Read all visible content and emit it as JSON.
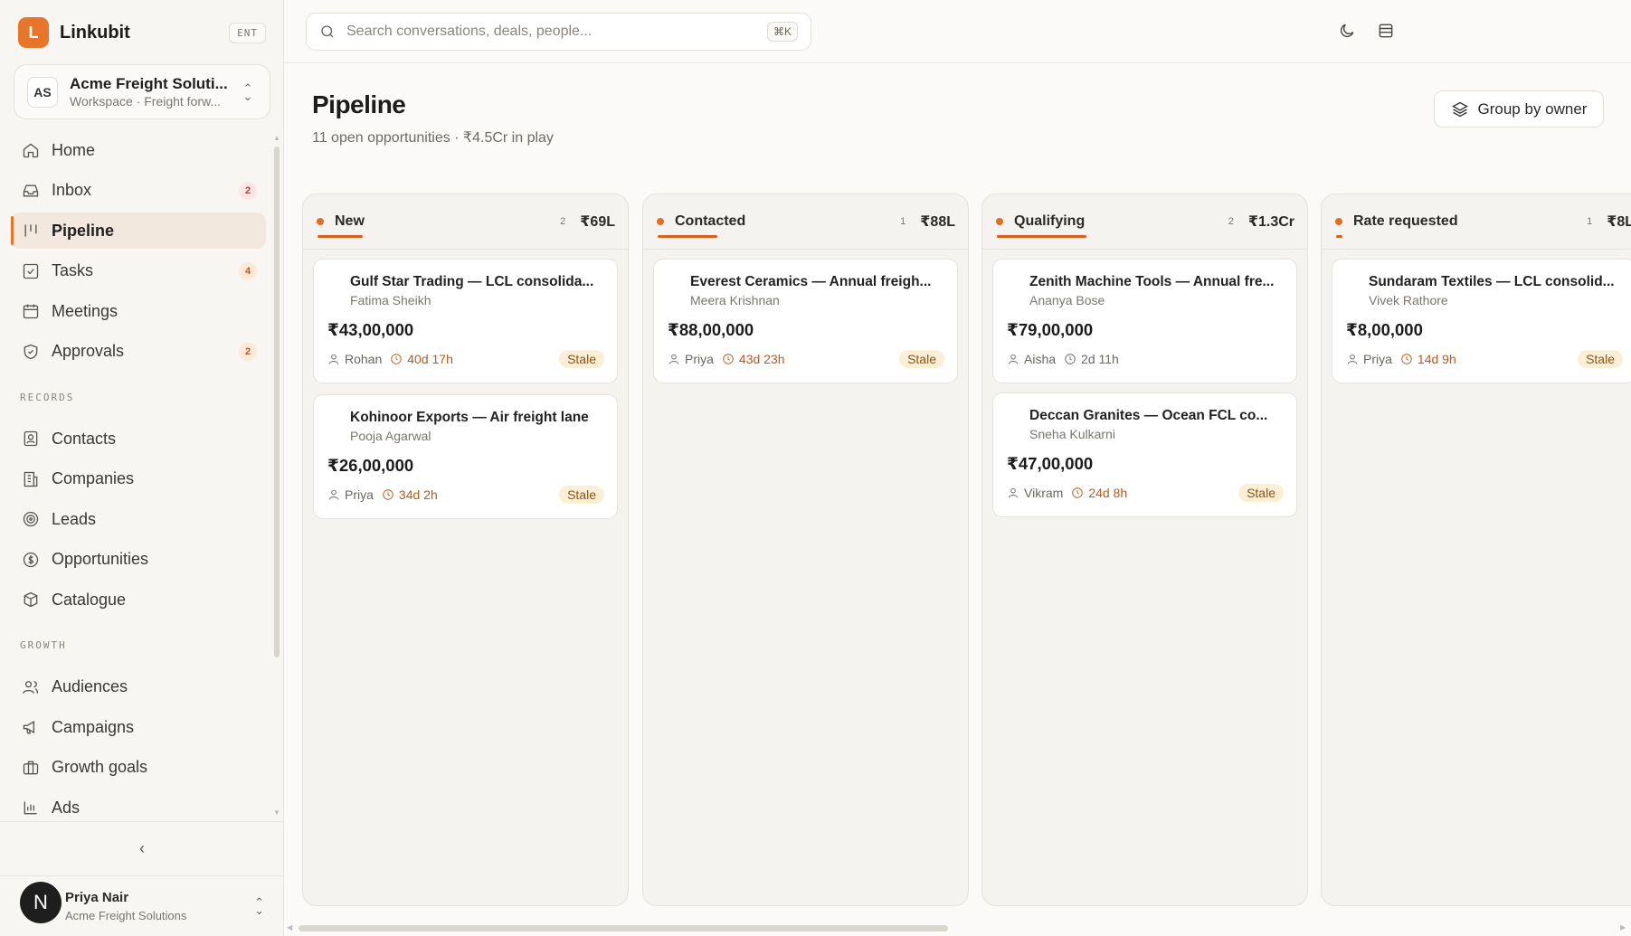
{
  "brand": {
    "logo_letter": "L",
    "name": "Linkubit",
    "badge": "ENT"
  },
  "workspace": {
    "initials": "AS",
    "name": "Acme Freight Soluti...",
    "subtitle": "Workspace · Freight forw..."
  },
  "nav": {
    "main": [
      {
        "label": "Home",
        "icon": "home-icon"
      },
      {
        "label": "Inbox",
        "icon": "inbox-icon",
        "count": "2"
      },
      {
        "label": "Pipeline",
        "icon": "pipeline-icon",
        "active": true
      },
      {
        "label": "Tasks",
        "icon": "tasks-icon",
        "count": "4"
      },
      {
        "label": "Meetings",
        "icon": "calendar-icon"
      },
      {
        "label": "Approvals",
        "icon": "shield-icon",
        "count": "2"
      }
    ],
    "records_label": "RECORDS",
    "records": [
      {
        "label": "Contacts",
        "icon": "contact-icon"
      },
      {
        "label": "Companies",
        "icon": "building-icon"
      },
      {
        "label": "Leads",
        "icon": "target-icon"
      },
      {
        "label": "Opportunities",
        "icon": "dollar-icon"
      },
      {
        "label": "Catalogue",
        "icon": "box-icon"
      }
    ],
    "growth_label": "GROWTH",
    "growth": [
      {
        "label": "Audiences",
        "icon": "users-icon"
      },
      {
        "label": "Campaigns",
        "icon": "megaphone-icon"
      },
      {
        "label": "Growth goals",
        "icon": "briefcase-icon"
      },
      {
        "label": "Ads",
        "icon": "bar-chart-icon"
      }
    ]
  },
  "user": {
    "initial": "N",
    "name": "Priya Nair",
    "org": "Acme Freight Solutions"
  },
  "search": {
    "placeholder": "Search conversations, deals, people...",
    "shortcut": "⌘K"
  },
  "page": {
    "title": "Pipeline",
    "subtitle": "11 open opportunities · ₹4.5Cr in play",
    "group_button": "Group by owner"
  },
  "columns": [
    {
      "title": "New",
      "count": "2",
      "total": "₹69L",
      "progress": 0.15,
      "cards": [
        {
          "title": "Gulf Star Trading — LCL consolida...",
          "contact": "Fatima Sheikh",
          "amount": "₹43,00,000",
          "owner": "Rohan",
          "age": "40d 17h",
          "stale": "Stale"
        },
        {
          "title": "Kohinoor Exports — Air freight lane",
          "contact": "Pooja Agarwal",
          "amount": "₹26,00,000",
          "owner": "Priya",
          "age": "34d 2h",
          "stale": "Stale"
        }
      ]
    },
    {
      "title": "Contacted",
      "count": "1",
      "total": "₹88L",
      "progress": 0.2,
      "cards": [
        {
          "title": "Everest Ceramics — Annual freigh...",
          "contact": "Meera Krishnan",
          "amount": "₹88,00,000",
          "owner": "Priya",
          "age": "43d 23h",
          "stale": "Stale"
        }
      ]
    },
    {
      "title": "Qualifying",
      "count": "2",
      "total": "₹1.3Cr",
      "progress": 0.3,
      "cards": [
        {
          "title": "Zenith Machine Tools — Annual fre...",
          "contact": "Ananya Bose",
          "amount": "₹79,00,000",
          "owner": "Aisha",
          "age": "2d 11h",
          "stale": ""
        },
        {
          "title": "Deccan Granites — Ocean FCL co...",
          "contact": "Sneha Kulkarni",
          "amount": "₹47,00,000",
          "owner": "Vikram",
          "age": "24d 8h",
          "stale": "Stale"
        }
      ]
    },
    {
      "title": "Rate requested",
      "count": "1",
      "total": "₹8L",
      "progress": 0.02,
      "cards": [
        {
          "title": "Sundaram Textiles — LCL consolid...",
          "contact": "Vivek Rathore",
          "amount": "₹8,00,000",
          "owner": "Priya",
          "age": "14d 9h",
          "stale": "Stale"
        }
      ]
    }
  ]
}
